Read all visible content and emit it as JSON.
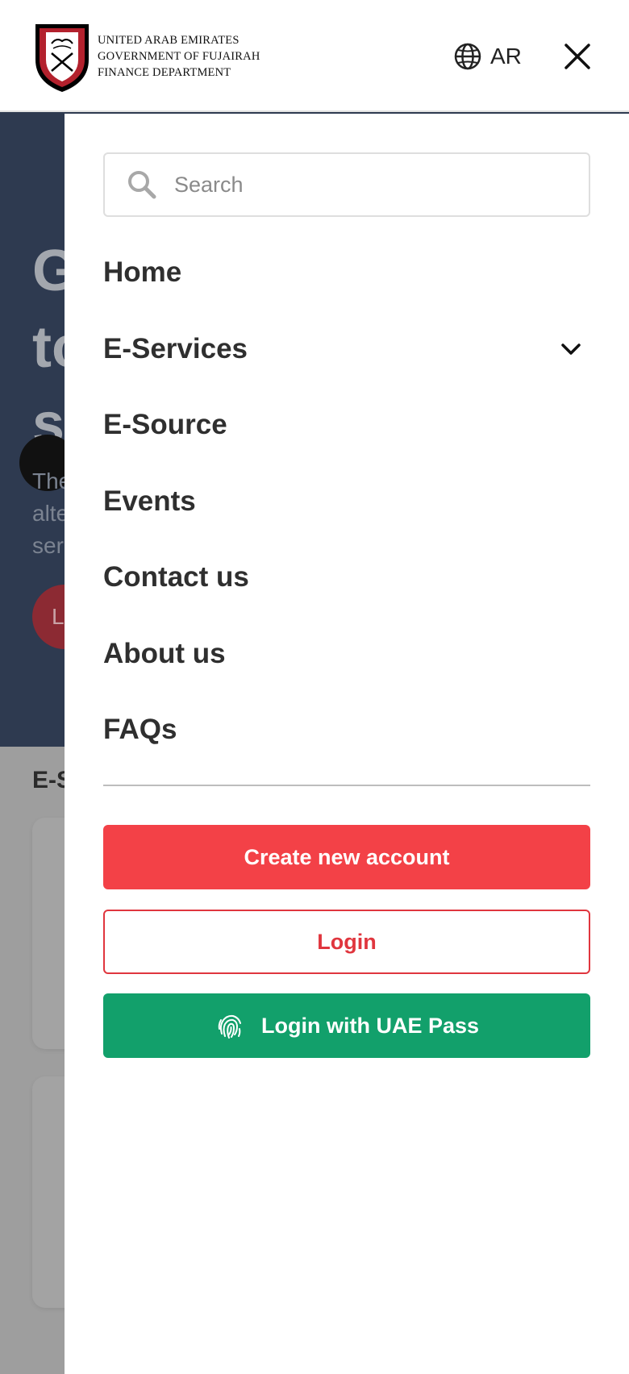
{
  "header": {
    "logo_lines": [
      "UNITED ARAB EMIRATES",
      "GOVERNMENT OF FUJAIRAH",
      "FINANCE DEPARTMENT"
    ],
    "language_label": "AR"
  },
  "background": {
    "hero_title_lines": [
      "G",
      "to",
      "se"
    ],
    "hero_sub_lines": [
      "The",
      "alte",
      "ser"
    ],
    "hero_button": "L",
    "section_label": "E-S"
  },
  "drawer": {
    "search_placeholder": "Search",
    "menu": [
      {
        "label": "Home",
        "has_submenu": false
      },
      {
        "label": "E-Services",
        "has_submenu": true
      },
      {
        "label": "E-Source",
        "has_submenu": false
      },
      {
        "label": "Events",
        "has_submenu": false
      },
      {
        "label": "Contact us",
        "has_submenu": false
      },
      {
        "label": "About us",
        "has_submenu": false
      },
      {
        "label": "FAQs",
        "has_submenu": false
      }
    ],
    "create_account_label": "Create new account",
    "login_label": "Login",
    "uae_pass_label": "Login with UAE Pass"
  },
  "colors": {
    "primary_red": "#f34147",
    "uae_green": "#12a06b",
    "text_dark": "#2f2f2f"
  },
  "icons": [
    "emblem-logo",
    "globe-icon",
    "close-icon",
    "search-icon",
    "chevron-down-icon",
    "fingerprint-icon"
  ]
}
